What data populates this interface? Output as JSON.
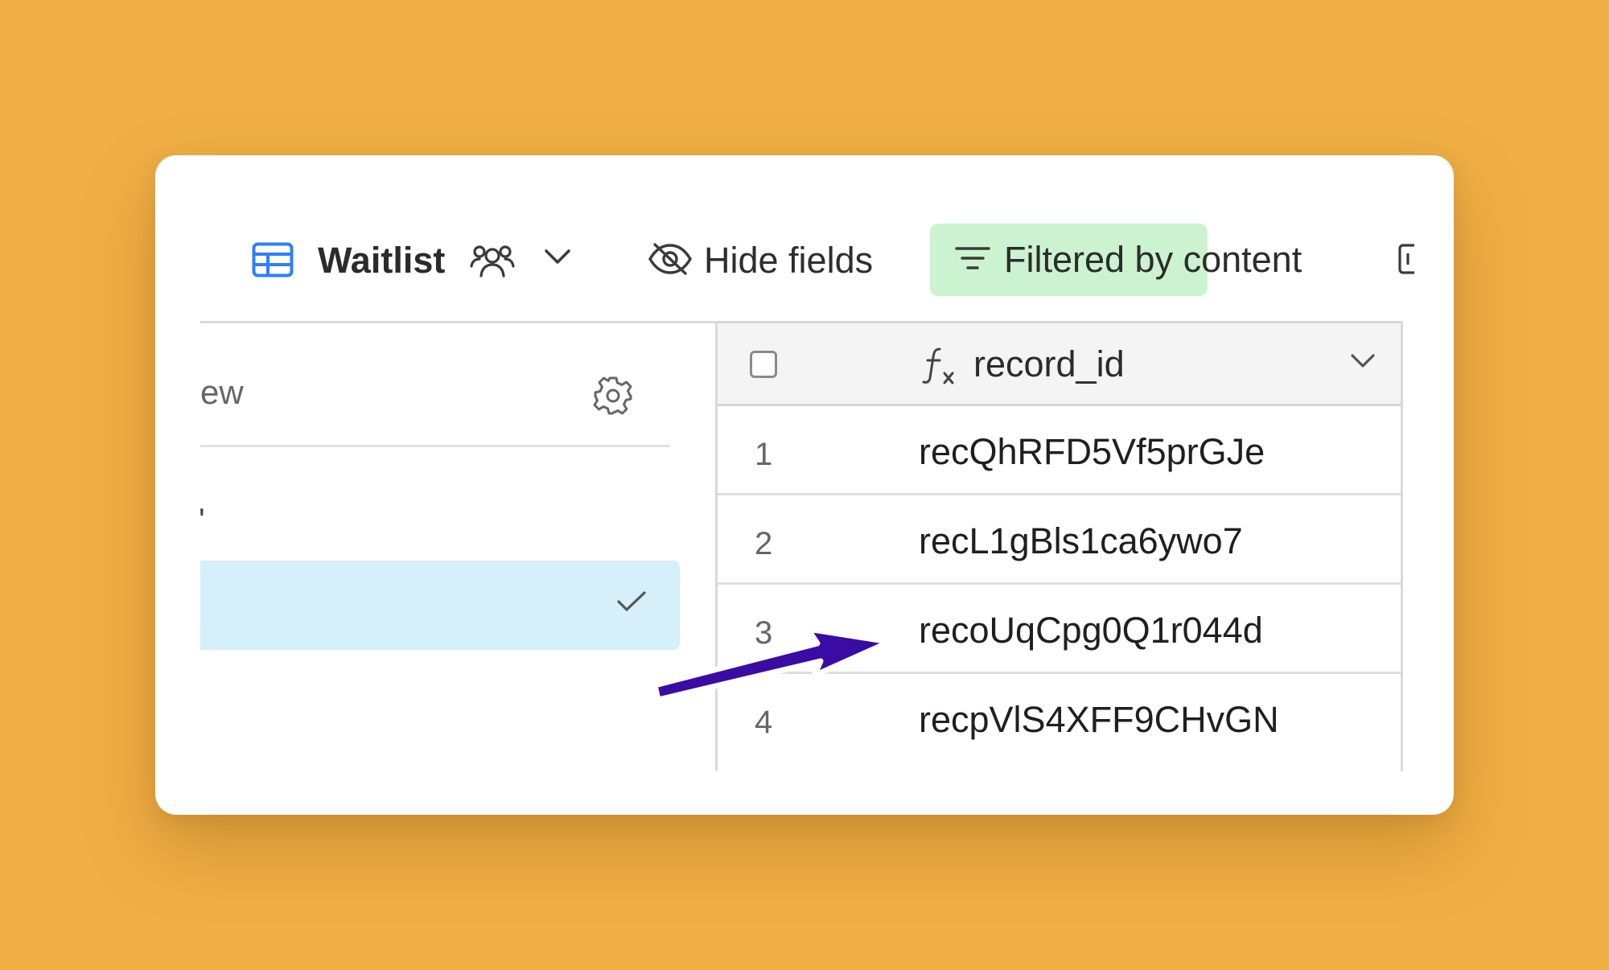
{
  "toolbar": {
    "view_icon": "grid-view-icon",
    "view_name": "Waitlist",
    "collaborative_icon": "users-icon",
    "view_menu_icon": "chevron-down-icon",
    "hide_fields": {
      "icon": "eye-off-icon",
      "label": "Hide fields"
    },
    "filter": {
      "icon": "filter-lines-icon",
      "label": "Filtered by content"
    },
    "colors": {
      "filter_bg": "#CCF3CF",
      "view_icon": "#2D7FF9"
    }
  },
  "sidebar": {
    "search_text": "ew",
    "settings_icon": "gear-icon",
    "partial_item": "'",
    "selected_icon": "check-icon",
    "colors": {
      "selected_bg": "#D5EFFB"
    }
  },
  "grid": {
    "column": {
      "icon": "formula-icon",
      "title": "record_id"
    },
    "rows": [
      {
        "num": "1",
        "value": "recQhRFD5Vf5prGJe"
      },
      {
        "num": "2",
        "value": "recL1gBls1ca6ywo7"
      },
      {
        "num": "3",
        "value": "recoUqCpg0Q1r044d"
      },
      {
        "num": "4",
        "value": "recpVlS4XFF9CHvGN"
      }
    ]
  },
  "annotation": {
    "icon": "pointer-arrow-icon",
    "color": "#3A0CA3"
  },
  "background": "#F0AF45"
}
